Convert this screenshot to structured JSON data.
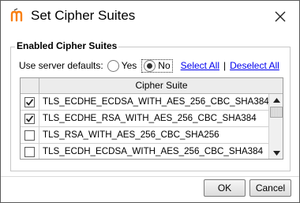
{
  "window": {
    "title": "Set Cipher Suites",
    "app_icon": "moodle-m-icon",
    "close_icon": "close-icon"
  },
  "group": {
    "legend": "Enabled Cipher Suites",
    "defaults_label": "Use server defaults:",
    "yes_label": "Yes",
    "no_label": "No",
    "selected": "No",
    "select_all": "Select All",
    "separator": "|",
    "deselect_all": "Deselect All"
  },
  "table": {
    "header": "Cipher Suite",
    "rows": [
      {
        "name": "TLS_ECDHE_ECDSA_WITH_AES_256_CBC_SHA384",
        "checked": true
      },
      {
        "name": "TLS_ECDHE_RSA_WITH_AES_256_CBC_SHA384",
        "checked": true
      },
      {
        "name": "TLS_RSA_WITH_AES_256_CBC_SHA256",
        "checked": false
      },
      {
        "name": "TLS_ECDH_ECDSA_WITH_AES_256_CBC_SHA384",
        "checked": false
      }
    ]
  },
  "buttons": {
    "ok": "OK",
    "cancel": "Cancel"
  },
  "colors": {
    "accent": "#f98012",
    "link": "#0000ee"
  }
}
